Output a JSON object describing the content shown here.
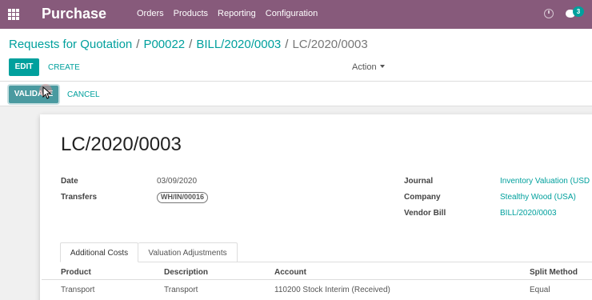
{
  "app": {
    "title": "Purchase"
  },
  "nav": {
    "menu": [
      "Orders",
      "Products",
      "Reporting",
      "Configuration"
    ],
    "chat_count": "3"
  },
  "breadcrumb": {
    "items": [
      "Requests for Quotation",
      "P00022",
      "BILL/2020/0003"
    ],
    "current": "LC/2020/0003",
    "separator": "/"
  },
  "toolbar": {
    "edit_label": "EDIT",
    "create_label": "CREATE",
    "action_label": "Action"
  },
  "status": {
    "validate_label": "VALIDATE",
    "cancel_label": "CANCEL"
  },
  "record": {
    "title": "LC/2020/0003",
    "date_label": "Date",
    "date_value": "03/09/2020",
    "transfers_label": "Transfers",
    "transfers_value": "WH/IN/00016",
    "journal_label": "Journal",
    "journal_value": "Inventory Valuation (USD",
    "company_label": "Company",
    "company_value": "Stealthy Wood (USA)",
    "vendor_bill_label": "Vendor Bill",
    "vendor_bill_value": "BILL/2020/0003"
  },
  "tabs": [
    {
      "label": "Additional Costs",
      "active": true
    },
    {
      "label": "Valuation Adjustments",
      "active": false
    }
  ],
  "table": {
    "headers": [
      "Product",
      "Description",
      "Account",
      "Split Method"
    ],
    "rows": [
      [
        "Transport",
        "Transport",
        "110200 Stock Interim (Received)",
        "Equal"
      ]
    ]
  },
  "colors": {
    "brand": "#875A7B",
    "accent": "#00A09D",
    "validate": "#4A9AA0"
  }
}
